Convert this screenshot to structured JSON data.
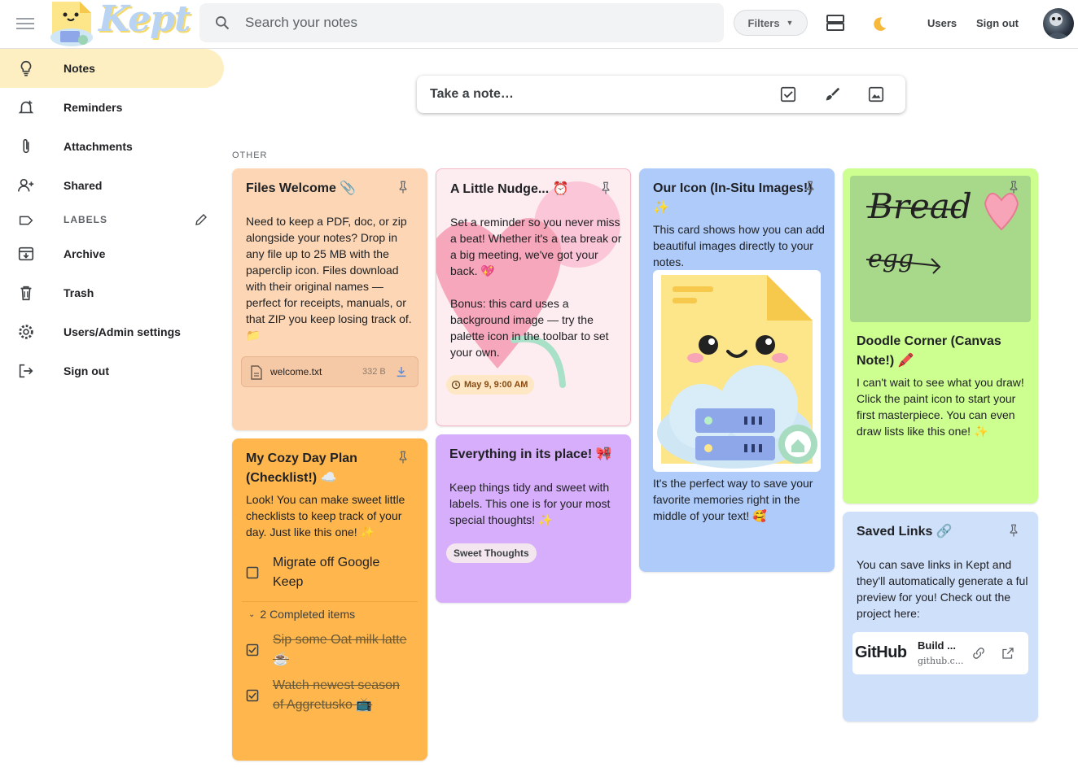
{
  "header": {
    "logo_text": "Kept",
    "search_placeholder": "Search your notes",
    "filters_label": "Filters",
    "users_label": "Users",
    "signout_label": "Sign out"
  },
  "sidebar": {
    "items": [
      {
        "label": "Notes",
        "icon": "lightbulb-icon"
      },
      {
        "label": "Reminders",
        "icon": "bell-plus-icon"
      },
      {
        "label": "Attachments",
        "icon": "paperclip-icon"
      },
      {
        "label": "Shared",
        "icon": "person-add-icon"
      }
    ],
    "labels_heading": "LABELS",
    "bottom_items": [
      {
        "label": "Archive",
        "icon": "archive-icon"
      },
      {
        "label": "Trash",
        "icon": "trash-icon"
      },
      {
        "label": "Users/Admin settings",
        "icon": "gear-icon"
      },
      {
        "label": "Sign out",
        "icon": "logout-icon"
      }
    ]
  },
  "composer": {
    "placeholder": "Take a note…"
  },
  "section_label": "OTHER",
  "notes": {
    "files": {
      "title": "Files Welcome 📎",
      "body": "Need to keep a PDF, doc, or zip alongside your notes? Drop in any file up to 25 MB with the paperclip icon. Files download with their original names — perfect for receipts, manuals, or that ZIP you keep losing track of. 📁",
      "attachment_name": "welcome.txt",
      "attachment_size": "332 B",
      "color": "#fcd6b5"
    },
    "nudge": {
      "title": "A Little Nudge... ⏰",
      "body1": "Set a reminder so you never miss a beat! Whether it's a tea break or a big meeting, we've got your back. 💖",
      "body2": "Bonus: this card uses a background image — try the palette icon in the toolbar to set your own.",
      "reminder": "May 9, 9:00 AM",
      "color": "#fdecf0"
    },
    "icon": {
      "title": "Our Icon (In-Situ Images!) ✨",
      "body1": "This card shows how you can add beautiful images directly to your notes.",
      "body2": "It's the perfect way to save your favorite memories right in the middle of your text! 🥰",
      "color": "#aecbfa"
    },
    "doodle": {
      "title": "Doodle Corner (Canvas Note!) 🖍️",
      "body": "I can't wait to see what you draw! Click the paint icon to start your first masterpiece. You can even draw lists like this one! ✨",
      "drawing_words": [
        "Bread",
        "egg"
      ],
      "color": "#ccff90"
    },
    "cozy": {
      "title": "My Cozy Day Plan (Checklist!) ☁️",
      "body": "Look! You can make sweet little checklists to keep track of your day. Just like this one! ✨",
      "item1": "Migrate off Google Keep",
      "completed_label": "2 Completed items",
      "done1": "Sip some Oat milk latte ☕",
      "done2": "Watch newest season of Aggretusko 📺",
      "color": "#ffb74d"
    },
    "place": {
      "title": "Everything in its place! 🎀",
      "body": "Keep things tidy and sweet with labels. This one is for your most special thoughts! ✨",
      "label_chip": "Sweet Thoughts",
      "color": "#d7aefb"
    },
    "links": {
      "title": "Saved Links 🔗",
      "body": "You can save links in Kept and they'll automatically generate a ful preview for you! Check out the project here:",
      "preview_brand": "GitHub",
      "preview_title": "Build ...",
      "preview_domain": "github.c...",
      "color": "#cfe0fb"
    }
  }
}
